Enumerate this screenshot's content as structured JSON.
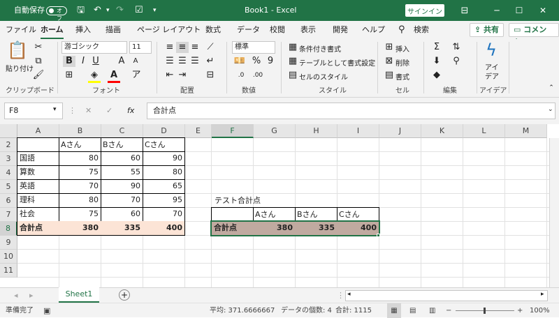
{
  "titlebar": {
    "autosave_label": "自動保存",
    "autosave_state": "オフ",
    "title": "Book1 - Excel",
    "signin": "サインイン",
    "save_icon": "save-icon",
    "undo_icon": "undo-icon",
    "redo_icon": "redo-icon",
    "minimize": "─",
    "maximize": "☐",
    "close": "✕"
  },
  "menu": {
    "tabs": [
      "ファイル",
      "ホーム",
      "挿入",
      "描画",
      "ページ レイアウト",
      "数式",
      "データ",
      "校閲",
      "表示",
      "開発",
      "ヘルプ"
    ],
    "active_tab": "ホーム",
    "search": "検索",
    "share": "共有",
    "comment": "コメント"
  },
  "ribbon": {
    "clipboard": {
      "paste": "貼り付け",
      "label": "クリップボード"
    },
    "font": {
      "name": "游ゴシック",
      "size": "11",
      "bold": "B",
      "italic": "I",
      "underline": "U",
      "label": "フォント"
    },
    "alignment": {
      "label": "配置"
    },
    "number": {
      "format": "標準",
      "percent": "%",
      "comma": "9",
      "label": "数値"
    },
    "styles": {
      "conditional": "条件付き書式",
      "table": "テーブルとして書式設定",
      "cell": "セルのスタイル",
      "label": "スタイル"
    },
    "cells": {
      "insert": "挿入",
      "delete": "削除",
      "format": "書式",
      "label": "セル"
    },
    "editing": {
      "label": "編集"
    },
    "ideas": {
      "button_line1": "アイ",
      "button_line2": "デア",
      "label": "アイデア"
    }
  },
  "formula_bar": {
    "name_box": "F8",
    "cancel": "✕",
    "enter": "✓",
    "fx": "fx",
    "content": "合計点"
  },
  "columns": [
    "A",
    "B",
    "C",
    "D",
    "E",
    "F",
    "G",
    "H",
    "I",
    "J",
    "K",
    "L",
    "M"
  ],
  "selected_column": "F",
  "rows": [
    "2",
    "3",
    "4",
    "5",
    "6",
    "7",
    "8",
    "9",
    "10",
    "11"
  ],
  "selected_row": "8",
  "table1": {
    "headers": [
      "",
      "Aさん",
      "Bさん",
      "Cさん"
    ],
    "rows": [
      {
        "label": "国語",
        "values": [
          "80",
          "60",
          "90"
        ]
      },
      {
        "label": "算数",
        "values": [
          "75",
          "55",
          "80"
        ]
      },
      {
        "label": "英語",
        "values": [
          "70",
          "90",
          "65"
        ]
      },
      {
        "label": "理科",
        "values": [
          "80",
          "70",
          "95"
        ]
      },
      {
        "label": "社会",
        "values": [
          "75",
          "60",
          "70"
        ]
      }
    ],
    "total": {
      "label": "合計点",
      "values": [
        "380",
        "335",
        "400"
      ]
    }
  },
  "table2": {
    "title": "テスト合計点",
    "headers": [
      "",
      "Aさん",
      "Bさん",
      "Cさん"
    ],
    "total": {
      "label": "合計点",
      "values": [
        "380",
        "335",
        "400"
      ]
    }
  },
  "sheet": {
    "tab": "Sheet1",
    "add": "+"
  },
  "status": {
    "ready": "準備完了",
    "average": "平均: 371.6666667",
    "count": "データの個数: 4",
    "sum": "合計: 1115",
    "zoom": "100%"
  },
  "colors": {
    "brand": "#217346",
    "sum_fill_a": "#fce4d6",
    "sum_fill_f": "#c0aaa0"
  }
}
